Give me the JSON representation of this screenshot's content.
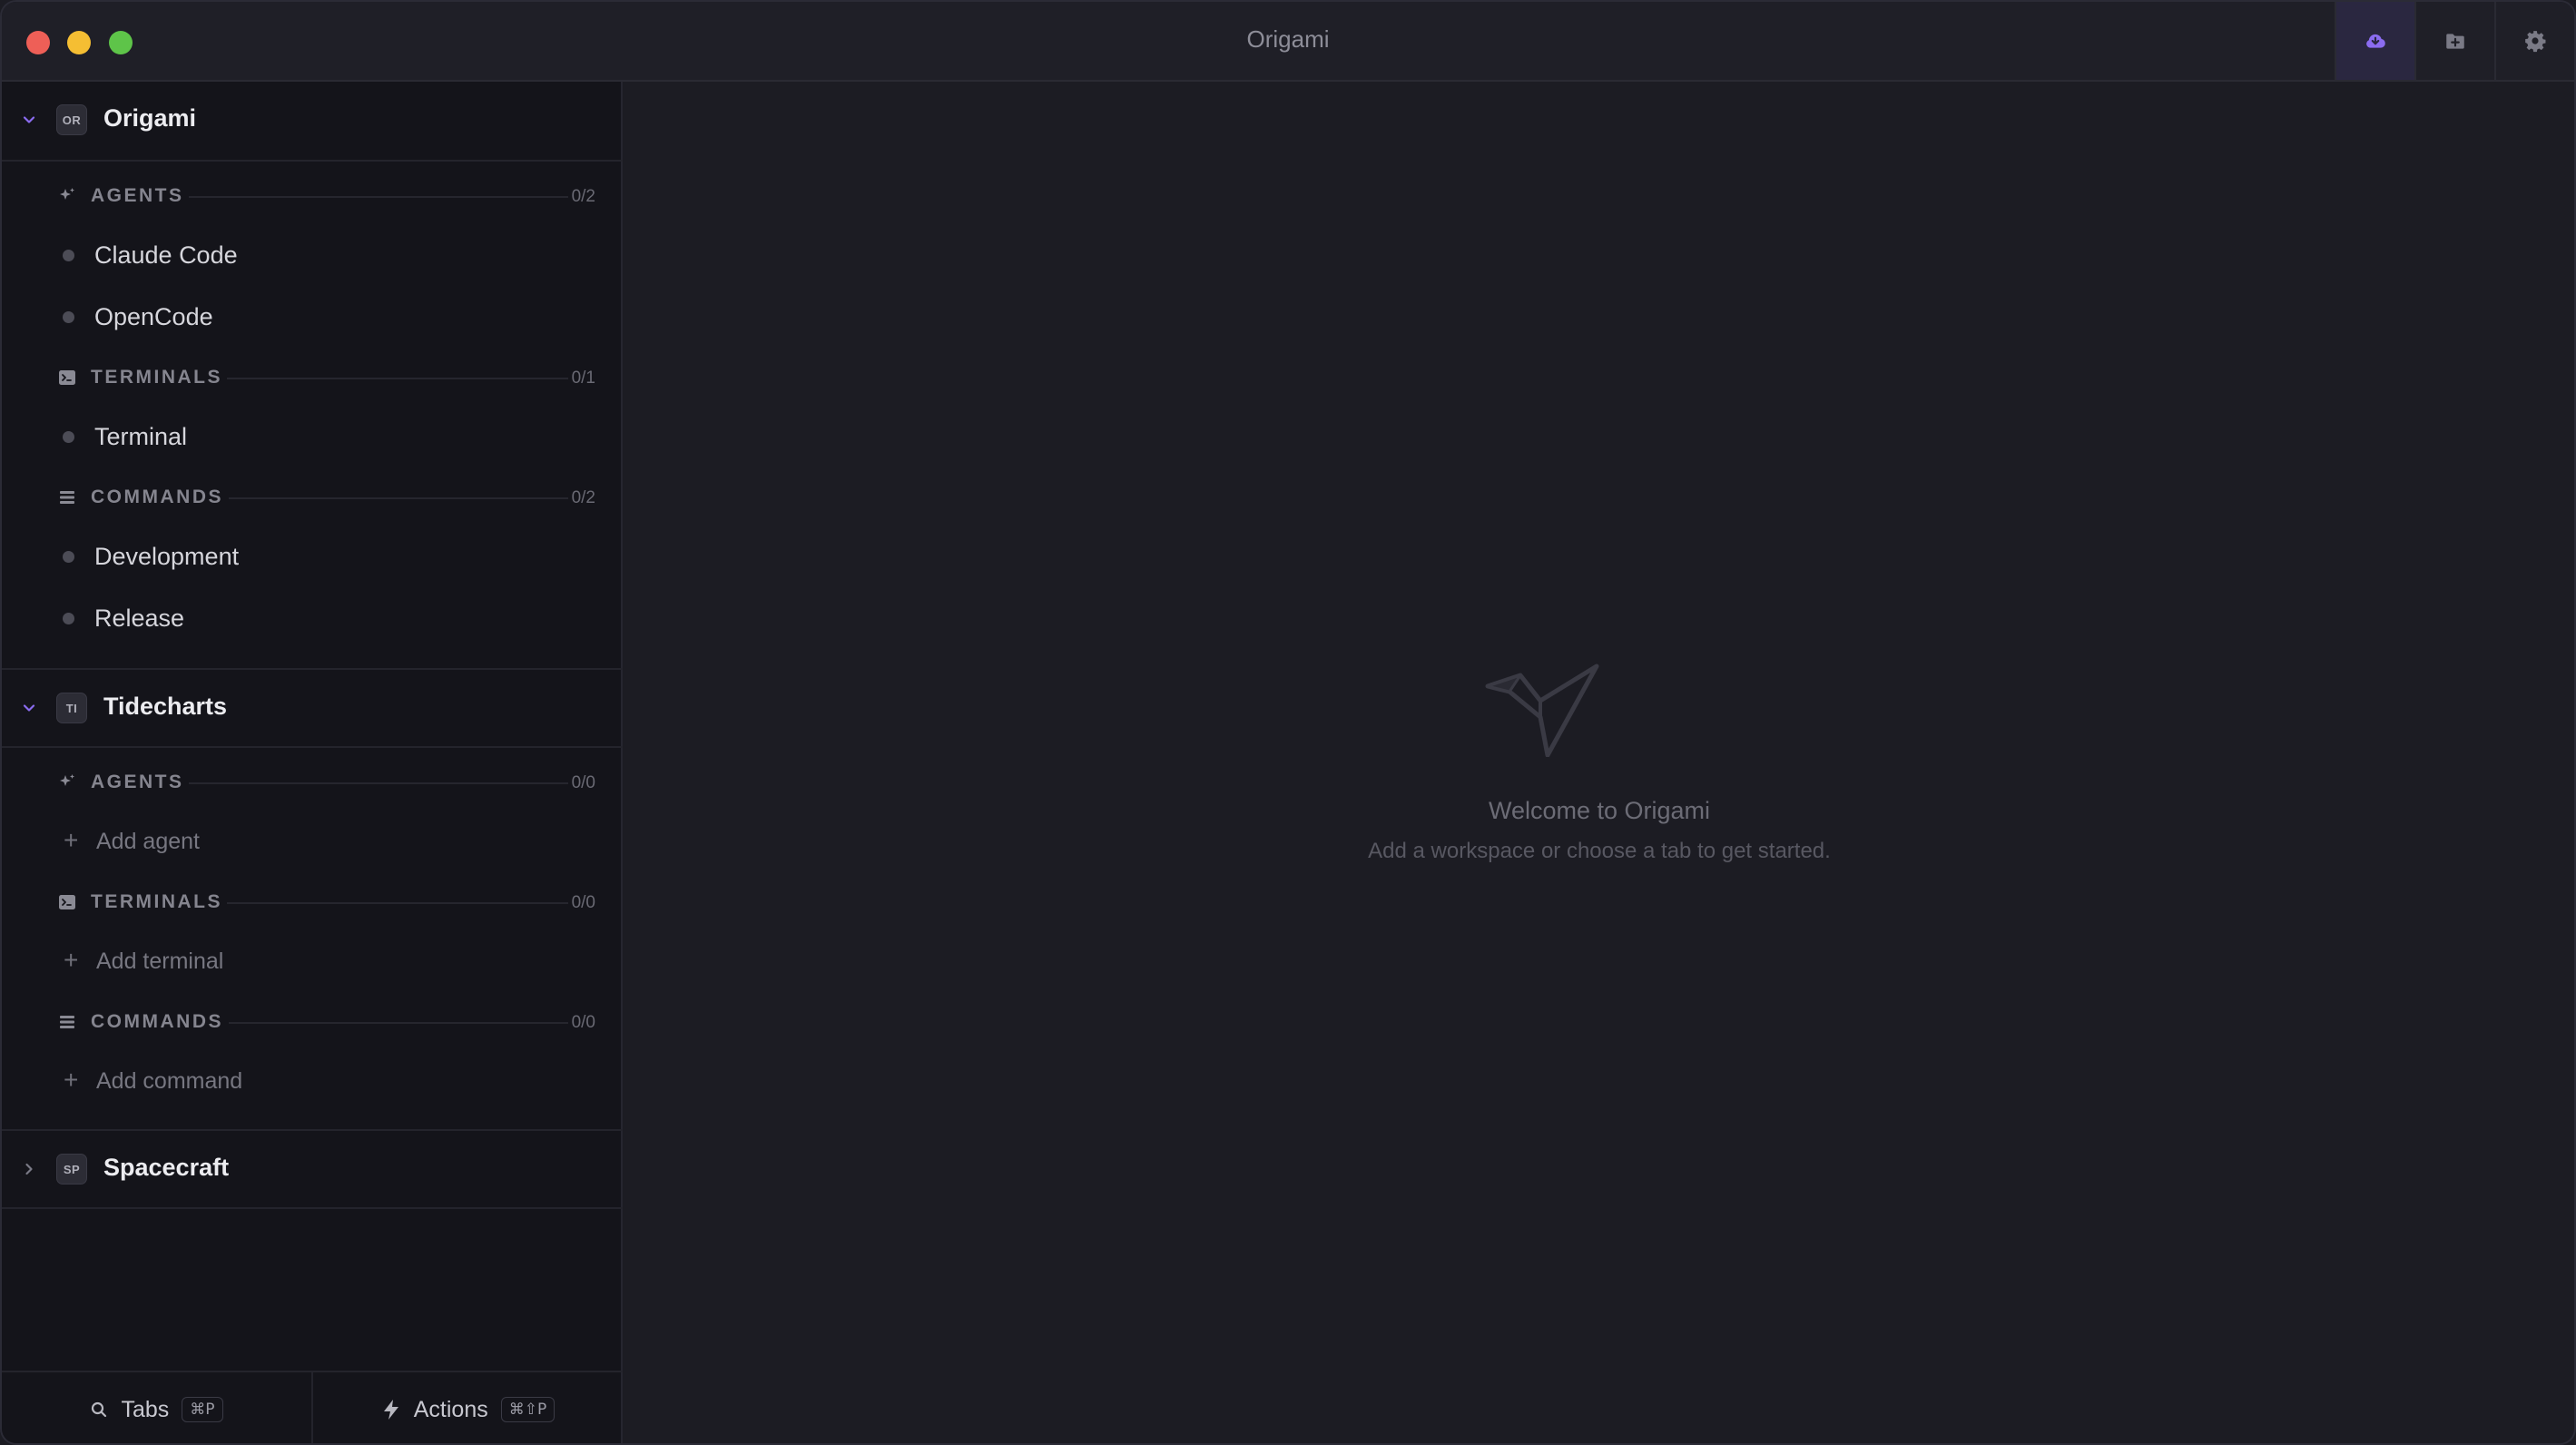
{
  "window": {
    "title": "Origami"
  },
  "colors": {
    "accent": "#8b6cf0",
    "close": "#ee5f57",
    "minimize": "#f5be33",
    "zoom": "#5ec449"
  },
  "toolbar": {
    "buttons": [
      {
        "name": "sync-icon",
        "active": true
      },
      {
        "name": "add-folder-icon",
        "active": false
      },
      {
        "name": "gear-icon",
        "active": false
      }
    ]
  },
  "workspaces": [
    {
      "badge": "OR",
      "name": "Origami",
      "expanded": true,
      "agents": {
        "label": "AGENTS",
        "count": "0/2",
        "items": [
          "Claude Code",
          "OpenCode"
        ]
      },
      "terminals": {
        "label": "TERMINALS",
        "count": "0/1",
        "items": [
          "Terminal"
        ]
      },
      "commands": {
        "label": "COMMANDS",
        "count": "0/2",
        "items": [
          "Development",
          "Release"
        ]
      }
    },
    {
      "badge": "TI",
      "name": "Tidecharts",
      "expanded": true,
      "agents": {
        "label": "AGENTS",
        "count": "0/0",
        "add": "Add agent"
      },
      "terminals": {
        "label": "TERMINALS",
        "count": "0/0",
        "add": "Add terminal"
      },
      "commands": {
        "label": "COMMANDS",
        "count": "0/0",
        "add": "Add command"
      }
    },
    {
      "badge": "SP",
      "name": "Spacecraft",
      "expanded": false
    }
  ],
  "footer": {
    "tabs": {
      "label": "Tabs",
      "shortcut": "⌘P"
    },
    "actions": {
      "label": "Actions",
      "shortcut": "⌘⇧P"
    }
  },
  "welcome": {
    "title": "Welcome to Origami",
    "subtitle": "Add a workspace or choose a tab to get started."
  }
}
